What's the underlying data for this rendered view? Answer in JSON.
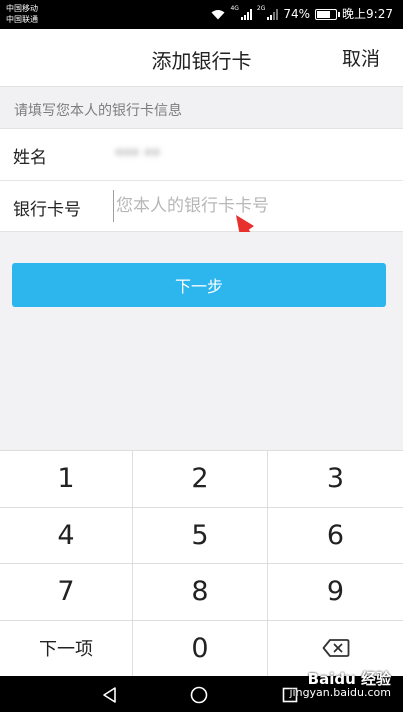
{
  "status_bar": {
    "carrier_1": "中国移动",
    "carrier_2": "中国联通",
    "network_1": "4G",
    "network_2": "2G",
    "battery": "74%",
    "battery_level": 0.74,
    "time": "晚上9:27"
  },
  "header": {
    "title": "添加银行卡",
    "cancel_label": "取消"
  },
  "form": {
    "hint": "请填写您本人的银行卡信息",
    "name_label": "姓名",
    "name_value": "*** **",
    "card_label": "银行卡号",
    "card_placeholder": "您本人的银行卡卡号"
  },
  "next_button": "下一步",
  "keypad": {
    "keys": [
      "1",
      "2",
      "3",
      "4",
      "5",
      "6",
      "7",
      "8",
      "9",
      "下一项",
      "0"
    ],
    "delete_icon": "backspace-icon"
  },
  "watermark": {
    "brand": "Baidu 经验",
    "url": "jingyan.baidu.com"
  },
  "colors": {
    "accent": "#2db5ee",
    "annotation_arrow": "#e8312f",
    "page_bg": "#f2f2f4"
  }
}
